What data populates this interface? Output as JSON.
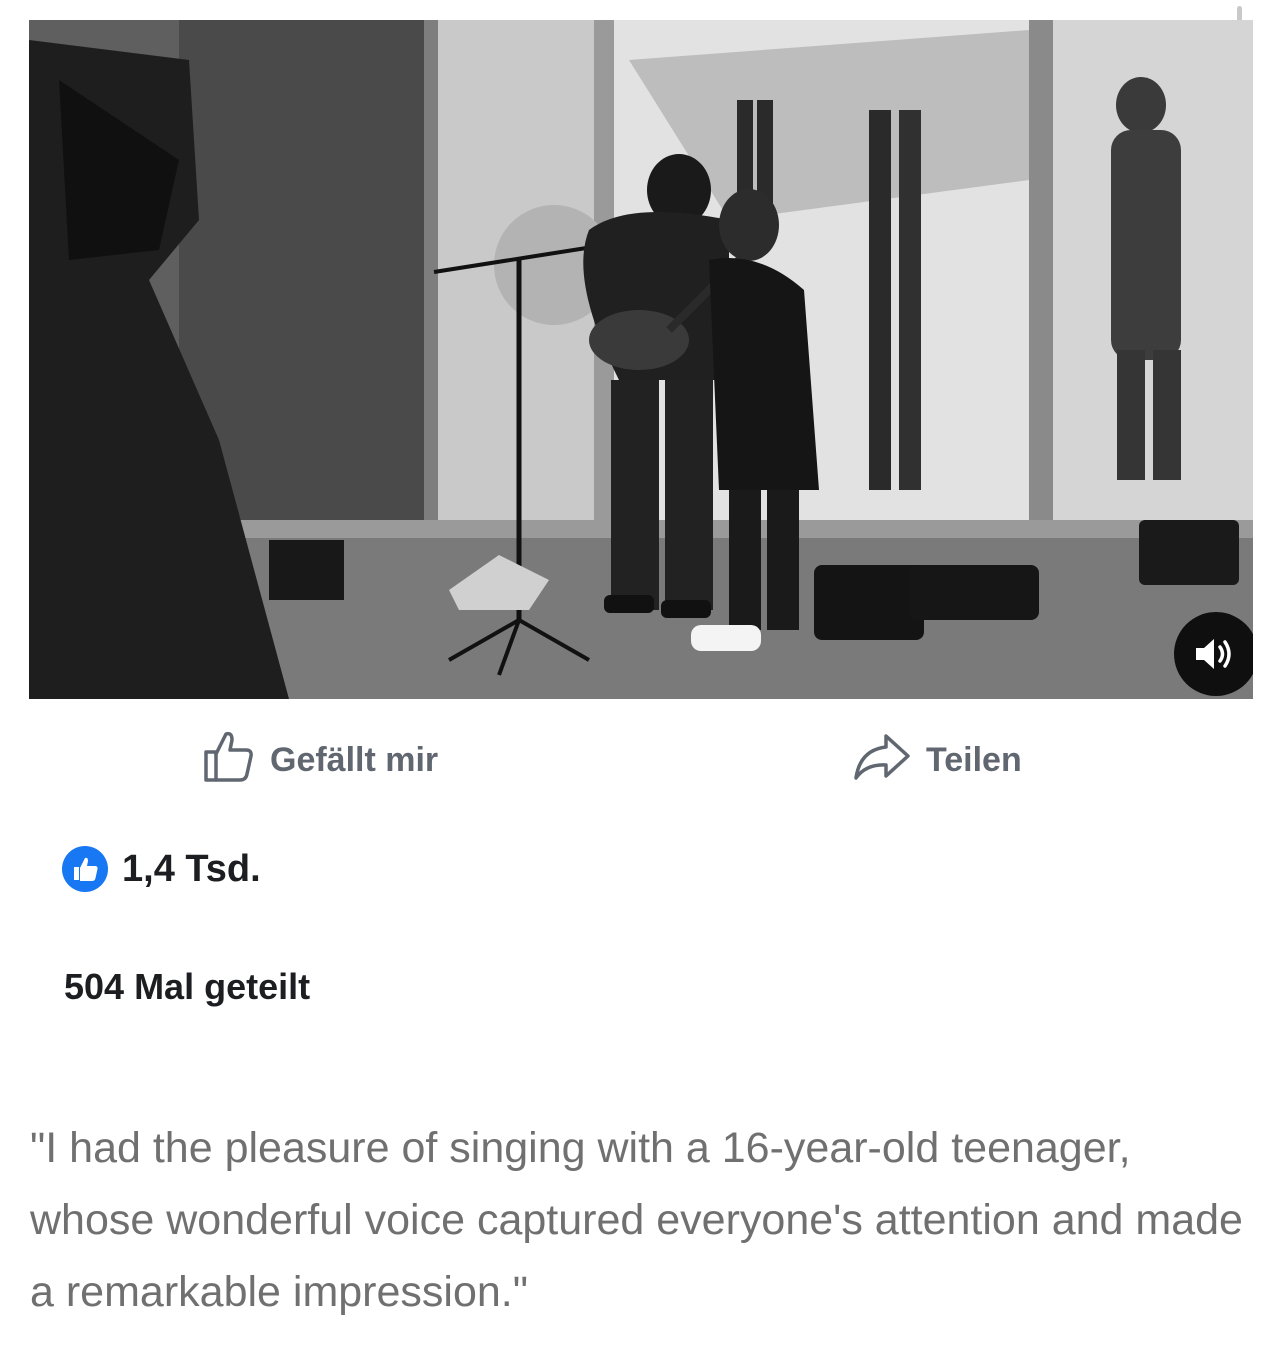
{
  "video": {
    "description_icon": "muted-speaker-icon"
  },
  "actions": {
    "like_label": "Gefällt mir",
    "share_label": "Teilen"
  },
  "stats": {
    "reactions_count": "1,4 Tsd.",
    "shares_text": "504 Mal geteilt"
  },
  "caption": {
    "text": "\"I had the pleasure of singing with a 16-year-old teenager, whose wonderful voice captured everyone's attention and made a remarkable impression.\""
  },
  "colors": {
    "accent": "#1877f2",
    "action_text": "#606770",
    "caption_text": "#707070"
  }
}
